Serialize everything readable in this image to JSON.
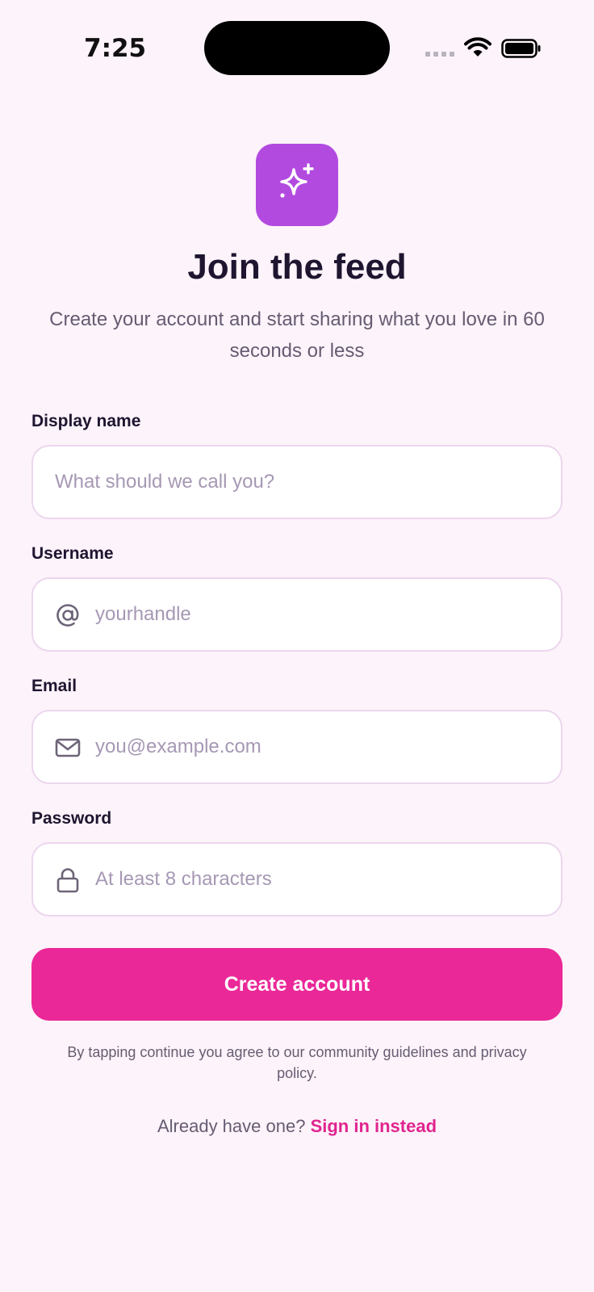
{
  "status_bar": {
    "time": "7:25",
    "icons": [
      "cellular-signal-icon",
      "wifi-icon",
      "battery-icon"
    ]
  },
  "header": {
    "logo_icon": "sparkles-icon",
    "logo_color": "#b24ae0",
    "title": "Join the feed",
    "subtitle": "Create your account and start sharing what you love in 60 seconds or less"
  },
  "form": {
    "display_name": {
      "label": "Display name",
      "placeholder": "What should we call you?",
      "value": ""
    },
    "username": {
      "label": "Username",
      "placeholder": "yourhandle",
      "value": "",
      "icon": "at-sign-icon"
    },
    "email": {
      "label": "Email",
      "placeholder": "you@example.com",
      "value": "",
      "icon": "mail-icon"
    },
    "password": {
      "label": "Password",
      "placeholder": "At least 8 characters",
      "value": "",
      "icon": "lock-icon"
    }
  },
  "actions": {
    "create_account_label": "Create account",
    "legal_text": "By tapping continue you agree to our community guidelines and privacy policy.",
    "signin_prompt": "Already have one?",
    "signin_link": "Sign in instead"
  },
  "colors": {
    "background": "#fdf3fa",
    "accent": "#ea2898",
    "logo": "#b24ae0",
    "field_border": "#ecd6ee"
  }
}
